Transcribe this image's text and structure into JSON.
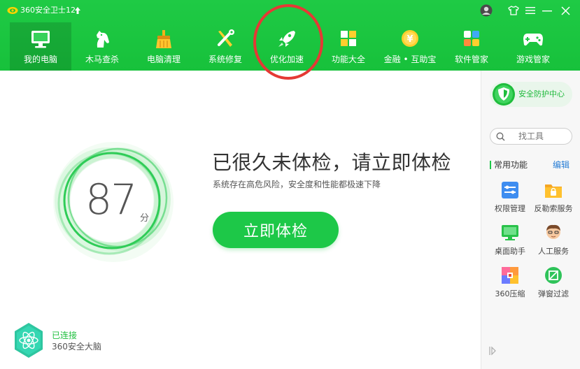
{
  "app": {
    "title": "360安全卫士12"
  },
  "nav": [
    {
      "key": "my-pc",
      "label": "我的电脑",
      "active": true,
      "icon": "monitor-icon"
    },
    {
      "key": "trojan",
      "label": "木马查杀",
      "icon": "horse-icon"
    },
    {
      "key": "cleanup",
      "label": "电脑清理",
      "icon": "broom-icon"
    },
    {
      "key": "repair",
      "label": "系统修复",
      "icon": "tools-icon"
    },
    {
      "key": "speedup",
      "label": "优化加速",
      "icon": "rocket-icon"
    },
    {
      "key": "features",
      "label": "功能大全",
      "icon": "grid-icon"
    },
    {
      "key": "finance",
      "label": "金融 • 互助宝",
      "icon": "yuan-coin-icon"
    },
    {
      "key": "software",
      "label": "软件管家",
      "icon": "blocks-icon"
    },
    {
      "key": "games",
      "label": "游戏管家",
      "icon": "gamepad-icon"
    }
  ],
  "main": {
    "score": "87",
    "score_unit": "分",
    "title": "已很久未体检，请立即体检",
    "subtitle": "系统存在高危风险，安全度和性能都极速下降",
    "check_button": "立即体检"
  },
  "brain": {
    "status": "已连接",
    "name": "360安全大脑"
  },
  "sidebar": {
    "protect_label": "安全防护中心",
    "search_placeholder": "找工具",
    "section_title": "常用功能",
    "edit_label": "编辑",
    "tools": [
      {
        "label": "权限管理",
        "icon": "permission-icon"
      },
      {
        "label": "反勒索服务",
        "icon": "folder-lock-icon"
      },
      {
        "label": "桌面助手",
        "icon": "desktop-assistant-icon"
      },
      {
        "label": "人工服务",
        "icon": "support-person-icon"
      },
      {
        "label": "360压缩",
        "icon": "compress-icon"
      },
      {
        "label": "弹窗过滤",
        "icon": "popup-filter-icon"
      }
    ]
  },
  "colors": {
    "brand": "#1dc848",
    "accent_blue": "#2a7fd6",
    "annotation": "#e53935"
  }
}
